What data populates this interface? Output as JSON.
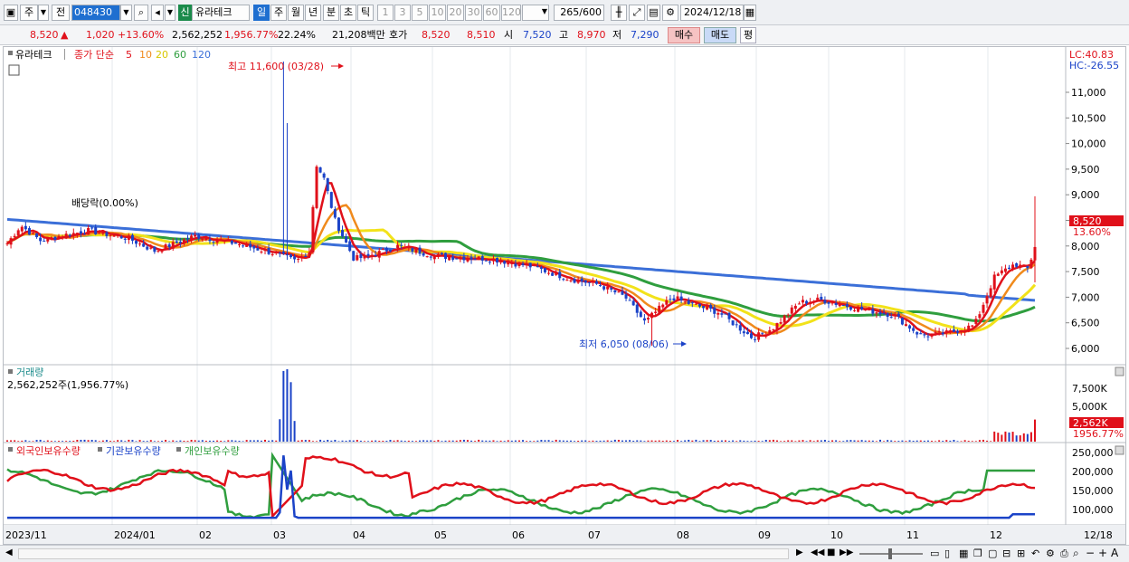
{
  "toolbar": {
    "market_tab": "주",
    "prev_label": "전",
    "stock_code": "048430",
    "stock_badge": "신",
    "stock_name": "유라테크",
    "periods": [
      "일",
      "주",
      "월",
      "년",
      "분",
      "초",
      "틱"
    ],
    "active_period": "일",
    "intervals": [
      "1",
      "3",
      "5",
      "10",
      "20",
      "30",
      "60",
      "120"
    ],
    "count_value": "265",
    "count_total": "/600",
    "date_value": "2024/12/18"
  },
  "info": {
    "price": "8,520",
    "change_arrow": "▲",
    "change": "1,020",
    "change_pct": "+13.60%",
    "volume": "2,562,252",
    "volume_ratio": "1,956.77%",
    "turnover": "22.24%",
    "amount": "21,208백만",
    "quote_label": "호가",
    "ask": "8,520",
    "bid": "8,510",
    "open_label": "시",
    "open": "7,520",
    "high_label": "고",
    "high": "8,970",
    "low_label": "저",
    "low": "7,290",
    "buy_label": "매수",
    "sell_label": "매도",
    "avg_label": "평"
  },
  "legend": {
    "name": "유라테크",
    "series_label": "종가 단순",
    "ma": [
      {
        "label": "5",
        "color": "#e0101a"
      },
      {
        "label": "10",
        "color": "#f08a1c"
      },
      {
        "label": "20",
        "color": "#f2e21a"
      },
      {
        "label": "60",
        "color": "#2f9e3e"
      },
      {
        "label": "120",
        "color": "#3b6fd8"
      }
    ],
    "lc": "LC:40.83",
    "hc": "HC:-26.55",
    "dividend": "배당락(0.00%)",
    "max_note": "최고 11,600 (03/28)",
    "min_note": "최저 6,050 (08/06)",
    "price_tag": "8,520",
    "pct_tag": "13.60%"
  },
  "price_axis": [
    "11,000",
    "10,500",
    "10,000",
    "9,500",
    "9,000",
    "8,500",
    "8,000",
    "7,500",
    "7,000",
    "6,500",
    "6,000"
  ],
  "volume_panel": {
    "title": "거래량",
    "value": "2,562,252주(1,956.77%)",
    "axis": [
      "7,500K",
      "5,000K"
    ],
    "tag": "2,562K",
    "tag2": "1956.77%"
  },
  "holdings_panel": {
    "series": [
      {
        "label": "외국인보유수량",
        "color": "#e0101a"
      },
      {
        "label": "기관보유수량",
        "color": "#1b43c8"
      },
      {
        "label": "개인보유수량",
        "color": "#2f9e3e"
      }
    ],
    "axis": [
      "250,000",
      "200,000",
      "150,000",
      "100,000"
    ]
  },
  "x_axis": [
    "2023/11",
    "2024/01",
    "02",
    "03",
    "04",
    "05",
    "06",
    "07",
    "08",
    "09",
    "10",
    "11",
    "12",
    "12/18"
  ],
  "colors": {
    "up": "#e0101a",
    "down": "#1b43c8",
    "accent": "#1f6fd0"
  }
}
